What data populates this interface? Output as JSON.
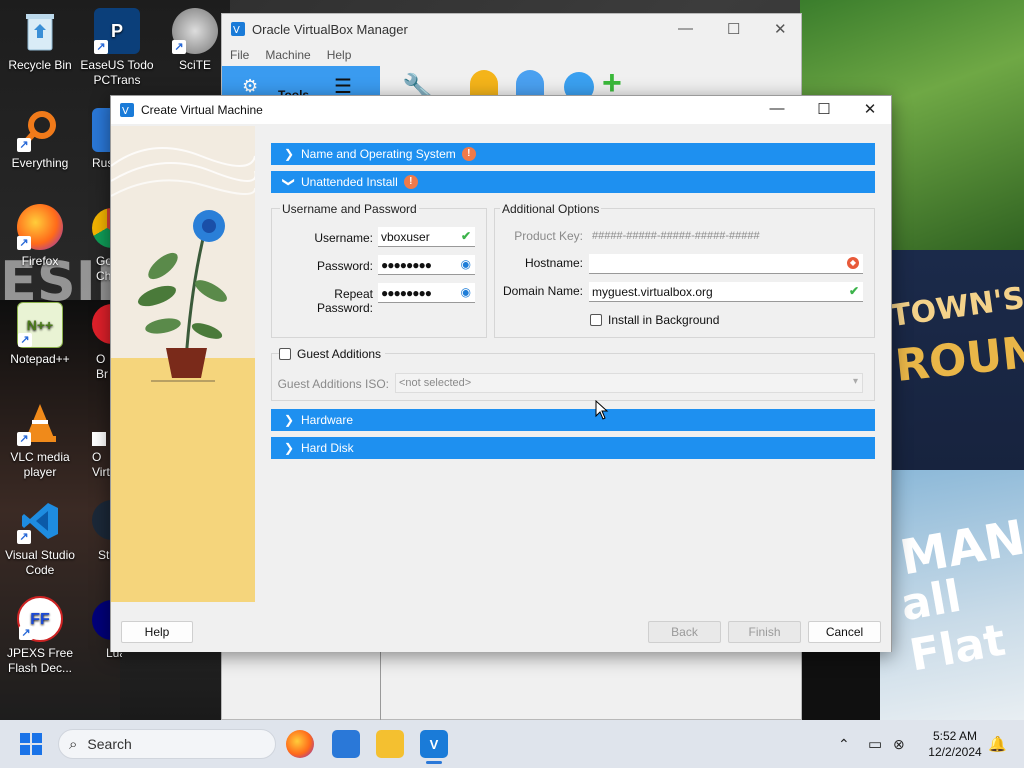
{
  "desktop": {
    "wallpaper_text": [
      "ESIM",
      "TOWN'S",
      "ROUNDS",
      "MAN",
      "all Flat"
    ],
    "icons": [
      {
        "label": "Recycle Bin",
        "icon": "recycle-bin-icon"
      },
      {
        "label": "EaseUS Todo PCTrans",
        "icon": "easeus-icon"
      },
      {
        "label": "SciTE",
        "icon": "scite-icon"
      },
      {
        "label": "Everything",
        "icon": "everything-icon"
      },
      {
        "label": "Rus",
        "icon": "rufus-icon"
      },
      {
        "label": "Firefox",
        "icon": "firefox-icon"
      },
      {
        "label": "Go Ch",
        "icon": "chrome-icon"
      },
      {
        "label": "Notepad++",
        "icon": "notepadpp-icon"
      },
      {
        "label": "O Br",
        "icon": "opera-icon"
      },
      {
        "label": "VLC media player",
        "icon": "vlc-icon"
      },
      {
        "label": "O Virt",
        "icon": "virtualbox-shortcut-icon"
      },
      {
        "label": "Visual Studio Code",
        "icon": "vscode-icon"
      },
      {
        "label": "St",
        "icon": "steam-icon"
      },
      {
        "label": "JPEXS Free Flash Dec...",
        "icon": "jpexs-icon"
      },
      {
        "label": "Lua",
        "icon": "lua-icon"
      }
    ]
  },
  "manager": {
    "title": "Oracle VirtualBox Manager",
    "menu": [
      "File",
      "Machine",
      "Help"
    ],
    "tools_label": "Tools"
  },
  "dialog": {
    "title": "Create Virtual Machine",
    "sections": {
      "name_os": "Name and Operating System",
      "unattended": "Unattended Install",
      "hardware": "Hardware",
      "hard_disk": "Hard Disk"
    },
    "user_group": {
      "title": "Username and Password",
      "username_label": "Username:",
      "username_value": "vboxuser",
      "password_label": "Password:",
      "password_value": "●●●●●●●●",
      "repeat_label": "Repeat Password:",
      "repeat_value": "●●●●●●●●"
    },
    "options_group": {
      "title": "Additional Options",
      "product_key_label": "Product Key:",
      "product_key_placeholder": "#####-#####-#####-#####-#####",
      "hostname_label": "Hostname:",
      "hostname_value": "",
      "domain_label": "Domain Name:",
      "domain_value": "myguest.virtualbox.org",
      "install_bg_label": "Install in Background"
    },
    "guest_additions": {
      "checkbox_label": "Guest Additions",
      "iso_label": "Guest Additions ISO:",
      "iso_value": "<not selected>"
    },
    "buttons": {
      "help": "Help",
      "back": "Back",
      "finish": "Finish",
      "cancel": "Cancel"
    }
  },
  "taskbar": {
    "search_placeholder": "Search",
    "time": "5:52 AM",
    "date": "12/2/2024"
  },
  "colors": {
    "section_bar": "#1e90f0",
    "warning": "#f07a4a",
    "ok_check": "#3bb34a"
  }
}
